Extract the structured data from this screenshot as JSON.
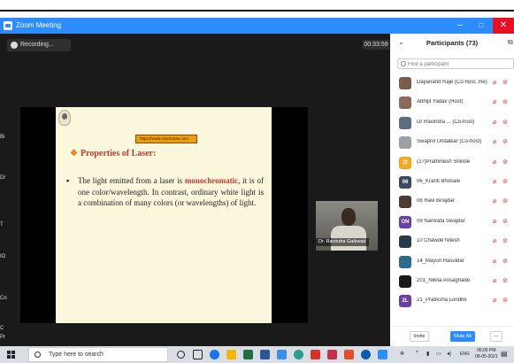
{
  "window": {
    "title": "Zoom Meeting",
    "min": "–",
    "max": "□",
    "close": "✕"
  },
  "meeting": {
    "recording_label": "Recording...",
    "timer": "00:33:59",
    "edge_labels": [
      "Bi",
      "Dr",
      "T",
      "IO",
      "Co",
      "C",
      "Pr"
    ]
  },
  "slide": {
    "url": "https://www.ncertnotes.com",
    "heading_bullet": "❖",
    "heading": "Properties of Laser:",
    "bullet": "▪",
    "text_before": "The light emitted from a laser is ",
    "text_highlight": "monochromatic",
    "text_after": ", it is of one color/wavelength. In contrast, ordinary white light is a combination of many colors (or wavelengths) of light."
  },
  "video": {
    "name": "Dr. Ravindra Gaikwad"
  },
  "participants": {
    "title": "Participants (73)",
    "search_placeholder": "Find a participant",
    "list": [
      {
        "name": "Dayanand Raje (Co-host, me)",
        "initials": "",
        "color": "#7a5c4a"
      },
      {
        "name": "Abhijit Yadav (Host)",
        "initials": "",
        "color": "#8b6a5a"
      },
      {
        "name": "Dr Ravindra ... (Co-host)",
        "initials": "",
        "color": "#5c6e7e"
      },
      {
        "name": "Swapnil Undalkar (Co-host)",
        "initials": "",
        "color": "#9aa0a6"
      },
      {
        "name": "(27)Prathmesh Shinde",
        "initials": "(2",
        "color": "#f5a623"
      },
      {
        "name": "06_Kranti Bhosale",
        "initials": "06",
        "color": "#3b4a5e"
      },
      {
        "name": "08 Ravi Birajdar",
        "initials": "",
        "color": "#4a3c30"
      },
      {
        "name": "09 Namrata Swajdar",
        "initials": "ON",
        "color": "#6b3fa0"
      },
      {
        "name": "10 Chawde Nilesh",
        "initials": "",
        "color": "#2a3a4a"
      },
      {
        "name": "14_Mayuri Hasuldar",
        "initials": "",
        "color": "#2e6b8a"
      },
      {
        "name": "201_Nikita Ansaghade",
        "initials": "",
        "color": "#1a1a1a"
      },
      {
        "name": "21_Pratiksha Londhe",
        "initials": "2L",
        "color": "#6b3fa0"
      }
    ],
    "invite": "Invite",
    "mute_all": "Mute All",
    "more": "..."
  },
  "taskbar": {
    "search_placeholder": "Type here to search",
    "lang": "ENG",
    "time": "06:05 PM",
    "date": "08-05-2021"
  }
}
